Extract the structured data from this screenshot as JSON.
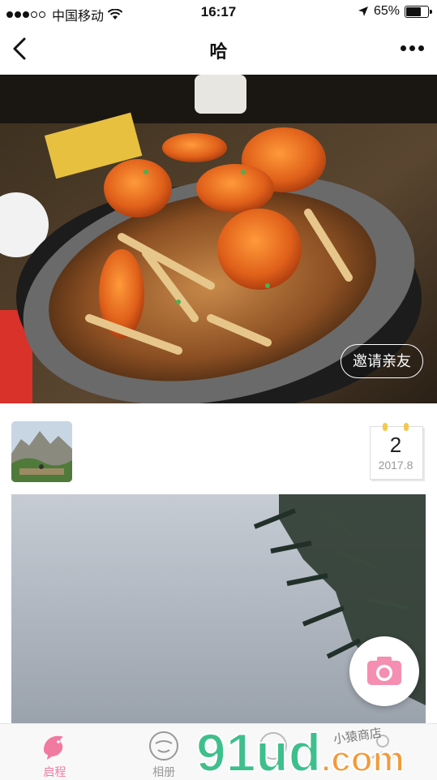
{
  "status_bar": {
    "carrier": "中国移动",
    "time": "16:17",
    "battery": "65%",
    "battery_level": 0.65
  },
  "nav": {
    "title": "哈",
    "back_icon": "chevron-left-icon",
    "more_icon": "more-dots-icon"
  },
  "hero": {
    "invite_label": "邀请亲友"
  },
  "entry": {
    "date_day": "2",
    "date_month": "2017.8"
  },
  "tabs": [
    {
      "label": "启程",
      "icon": "dolphin-icon",
      "active": true
    },
    {
      "label": "相册",
      "icon": "face-icon",
      "active": false
    },
    {
      "label": "",
      "icon": "tab-3-icon",
      "active": false
    },
    {
      "label": "",
      "icon": "tab-4-icon",
      "active": false
    }
  ],
  "watermark": {
    "text": "91ud.com",
    "subtext": "小猿商店"
  },
  "colors": {
    "accent_pink": "#f07aa0",
    "watermark_green": "#3fbf8c",
    "watermark_orange": "#f29a3b"
  }
}
